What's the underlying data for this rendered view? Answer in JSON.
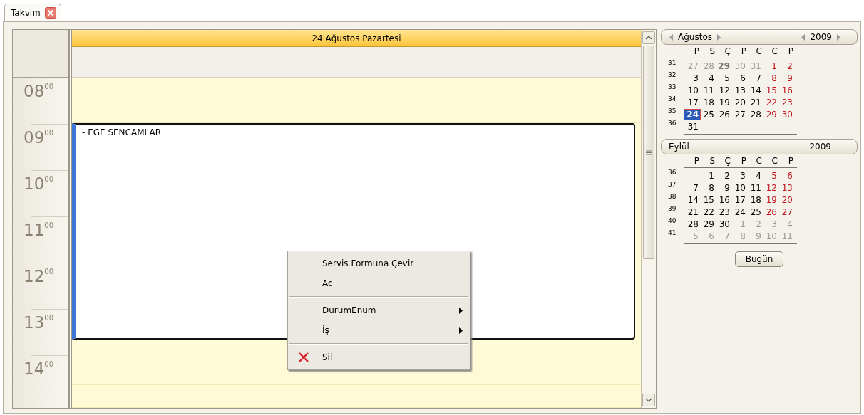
{
  "tabs": [
    {
      "label": "Takvim",
      "selected": true
    }
  ],
  "scheduler": {
    "day_header": "24 Ağustos Pazartesi",
    "hours": [
      {
        "hour": "08",
        "minutes": "00"
      },
      {
        "hour": "09",
        "minutes": "00"
      },
      {
        "hour": "10",
        "minutes": "00"
      },
      {
        "hour": "11",
        "minutes": "00"
      },
      {
        "hour": "12",
        "minutes": "00"
      },
      {
        "hour": "13",
        "minutes": "00"
      },
      {
        "hour": "14",
        "minutes": "00"
      }
    ],
    "timeline": [
      {
        "kind": "slot"
      },
      {
        "kind": "slot"
      },
      {
        "kind": "appointment",
        "title": "- EGE SENCAMLAR"
      },
      {
        "kind": "slot"
      },
      {
        "kind": "slot"
      },
      {
        "kind": "slot"
      }
    ]
  },
  "context_menu": [
    {
      "kind": "item",
      "label": "Servis Formuna Çevir"
    },
    {
      "kind": "item",
      "label": "Aç"
    },
    {
      "kind": "separator"
    },
    {
      "kind": "submenu",
      "label": "DurumEnum"
    },
    {
      "kind": "submenu",
      "label": "İş"
    },
    {
      "kind": "separator"
    },
    {
      "kind": "delete",
      "label": "Sil"
    }
  ],
  "calendars": [
    {
      "month": "Ağustos",
      "year": "2009",
      "arrows": true,
      "weekdays": [
        "P",
        "S",
        "Ç",
        "P",
        "C",
        "C",
        "P"
      ],
      "weeks": [
        {
          "week": "31",
          "days": [
            {
              "d": "27",
              "kind": "other"
            },
            {
              "d": "28",
              "kind": "other"
            },
            {
              "d": "29",
              "kind": "marked"
            },
            {
              "d": "30",
              "kind": "other"
            },
            {
              "d": "31",
              "kind": "other"
            },
            {
              "d": "1",
              "kind": "weekend"
            },
            {
              "d": "2",
              "kind": "weekend"
            }
          ]
        },
        {
          "week": "32",
          "days": [
            {
              "d": "3",
              "kind": "day"
            },
            {
              "d": "4",
              "kind": "day"
            },
            {
              "d": "5",
              "kind": "day"
            },
            {
              "d": "6",
              "kind": "day"
            },
            {
              "d": "7",
              "kind": "day"
            },
            {
              "d": "8",
              "kind": "weekend"
            },
            {
              "d": "9",
              "kind": "weekend"
            }
          ]
        },
        {
          "week": "33",
          "days": [
            {
              "d": "10",
              "kind": "day"
            },
            {
              "d": "11",
              "kind": "day"
            },
            {
              "d": "12",
              "kind": "day"
            },
            {
              "d": "13",
              "kind": "day"
            },
            {
              "d": "14",
              "kind": "day"
            },
            {
              "d": "15",
              "kind": "weekend"
            },
            {
              "d": "16",
              "kind": "weekend"
            }
          ]
        },
        {
          "week": "34",
          "days": [
            {
              "d": "17",
              "kind": "day"
            },
            {
              "d": "18",
              "kind": "day"
            },
            {
              "d": "19",
              "kind": "day"
            },
            {
              "d": "20",
              "kind": "day"
            },
            {
              "d": "21",
              "kind": "day"
            },
            {
              "d": "22",
              "kind": "weekend"
            },
            {
              "d": "23",
              "kind": "weekend"
            }
          ]
        },
        {
          "week": "35",
          "days": [
            {
              "d": "24",
              "kind": "selected"
            },
            {
              "d": "25",
              "kind": "day"
            },
            {
              "d": "26",
              "kind": "day"
            },
            {
              "d": "27",
              "kind": "day"
            },
            {
              "d": "28",
              "kind": "day"
            },
            {
              "d": "29",
              "kind": "weekend"
            },
            {
              "d": "30",
              "kind": "weekend"
            }
          ]
        },
        {
          "week": "36",
          "days": [
            {
              "d": "31",
              "kind": "day"
            }
          ]
        }
      ]
    },
    {
      "month": "Eylül",
      "year": "2009",
      "arrows": false,
      "weekdays": [
        "P",
        "S",
        "Ç",
        "P",
        "C",
        "C",
        "P"
      ],
      "weeks": [
        {
          "week": "36",
          "days": [
            {
              "d": "1",
              "kind": "day"
            },
            {
              "d": "2",
              "kind": "day"
            },
            {
              "d": "3",
              "kind": "day"
            },
            {
              "d": "4",
              "kind": "day"
            },
            {
              "d": "5",
              "kind": "weekend"
            },
            {
              "d": "6",
              "kind": "weekend"
            }
          ]
        },
        {
          "week": "37",
          "days": [
            {
              "d": "7",
              "kind": "day"
            },
            {
              "d": "8",
              "kind": "day"
            },
            {
              "d": "9",
              "kind": "day"
            },
            {
              "d": "10",
              "kind": "day"
            },
            {
              "d": "11",
              "kind": "day"
            },
            {
              "d": "12",
              "kind": "weekend"
            },
            {
              "d": "13",
              "kind": "weekend"
            }
          ]
        },
        {
          "week": "38",
          "days": [
            {
              "d": "14",
              "kind": "day"
            },
            {
              "d": "15",
              "kind": "day"
            },
            {
              "d": "16",
              "kind": "day"
            },
            {
              "d": "17",
              "kind": "day"
            },
            {
              "d": "18",
              "kind": "day"
            },
            {
              "d": "19",
              "kind": "weekend"
            },
            {
              "d": "20",
              "kind": "weekend"
            }
          ]
        },
        {
          "week": "39",
          "days": [
            {
              "d": "21",
              "kind": "day"
            },
            {
              "d": "22",
              "kind": "day"
            },
            {
              "d": "23",
              "kind": "day"
            },
            {
              "d": "24",
              "kind": "day"
            },
            {
              "d": "25",
              "kind": "day"
            },
            {
              "d": "26",
              "kind": "weekend"
            },
            {
              "d": "27",
              "kind": "weekend"
            }
          ]
        },
        {
          "week": "40",
          "days": [
            {
              "d": "28",
              "kind": "day"
            },
            {
              "d": "29",
              "kind": "day"
            },
            {
              "d": "30",
              "kind": "day"
            },
            {
              "d": "1",
              "kind": "other"
            },
            {
              "d": "2",
              "kind": "other"
            },
            {
              "d": "3",
              "kind": "other"
            },
            {
              "d": "4",
              "kind": "other"
            }
          ]
        },
        {
          "week": "41",
          "days": [
            {
              "d": "5",
              "kind": "other"
            },
            {
              "d": "6",
              "kind": "other"
            },
            {
              "d": "7",
              "kind": "other"
            },
            {
              "d": "8",
              "kind": "other"
            },
            {
              "d": "9",
              "kind": "other"
            },
            {
              "d": "10",
              "kind": "other"
            },
            {
              "d": "11",
              "kind": "other"
            }
          ]
        }
      ]
    }
  ],
  "today_button": "Bugün"
}
